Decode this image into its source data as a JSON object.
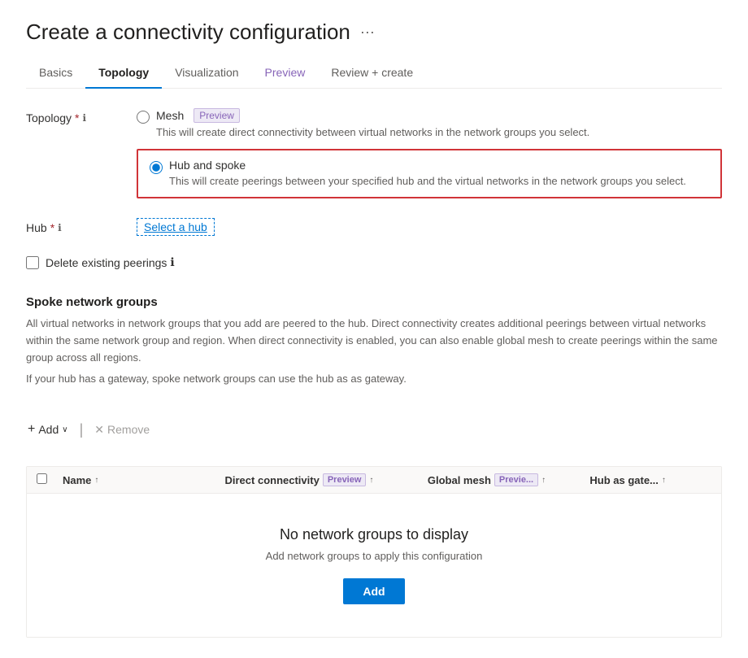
{
  "page": {
    "title": "Create a connectivity configuration",
    "ellipsis": "···"
  },
  "tabs": [
    {
      "id": "basics",
      "label": "Basics",
      "active": false,
      "preview": false
    },
    {
      "id": "topology",
      "label": "Topology",
      "active": true,
      "preview": false
    },
    {
      "id": "visualization",
      "label": "Visualization",
      "active": false,
      "preview": false
    },
    {
      "id": "preview",
      "label": "Preview",
      "active": false,
      "preview": true
    },
    {
      "id": "review",
      "label": "Review + create",
      "active": false,
      "preview": false
    }
  ],
  "topology": {
    "label": "Topology",
    "required_marker": "*",
    "info_icon": "ℹ",
    "mesh_label": "Mesh",
    "mesh_badge": "Preview",
    "mesh_desc_part1": "This will create direct connectivity between virtual networks in the network groups",
    "mesh_desc_link": "network groups",
    "mesh_desc_part2": "you select.",
    "hub_spoke_label": "Hub and spoke",
    "hub_spoke_desc_part1": "This will create peerings between your specified hub and the virtual networks in the",
    "hub_spoke_desc_link": "virtual networks",
    "hub_spoke_desc_part2": "network groups you select."
  },
  "hub": {
    "label": "Hub",
    "required_marker": "*",
    "info_icon": "ℹ",
    "select_link": "Select a hub"
  },
  "delete_peerings": {
    "label": "Delete existing peerings",
    "info_icon": "ℹ"
  },
  "spoke_groups": {
    "heading": "Spoke network groups",
    "desc1": "All virtual networks in network groups that you add are peered to the hub. Direct connectivity creates additional peerings between virtual networks within the same network group and region. When direct connectivity is enabled, you can also enable global mesh to create peerings within the same group across all regions.",
    "desc2": "If your hub has a gateway, spoke network groups can use the hub as as gateway."
  },
  "toolbar": {
    "add_label": "Add",
    "remove_label": "Remove",
    "add_icon": "+",
    "chevron_icon": "∨",
    "remove_icon": "✕"
  },
  "table": {
    "headers": [
      {
        "id": "name",
        "label": "Name",
        "sort": "↑"
      },
      {
        "id": "direct",
        "label": "Direct connectivity",
        "badge": "Preview",
        "sort": "↑"
      },
      {
        "id": "global",
        "label": "Global mesh",
        "badge": "Previe...",
        "sort": "↑"
      },
      {
        "id": "hub",
        "label": "Hub as gate...",
        "sort": "↑"
      }
    ]
  },
  "empty_state": {
    "title": "No network groups to display",
    "desc": "Add network groups to apply this configuration",
    "add_btn": "Add"
  }
}
